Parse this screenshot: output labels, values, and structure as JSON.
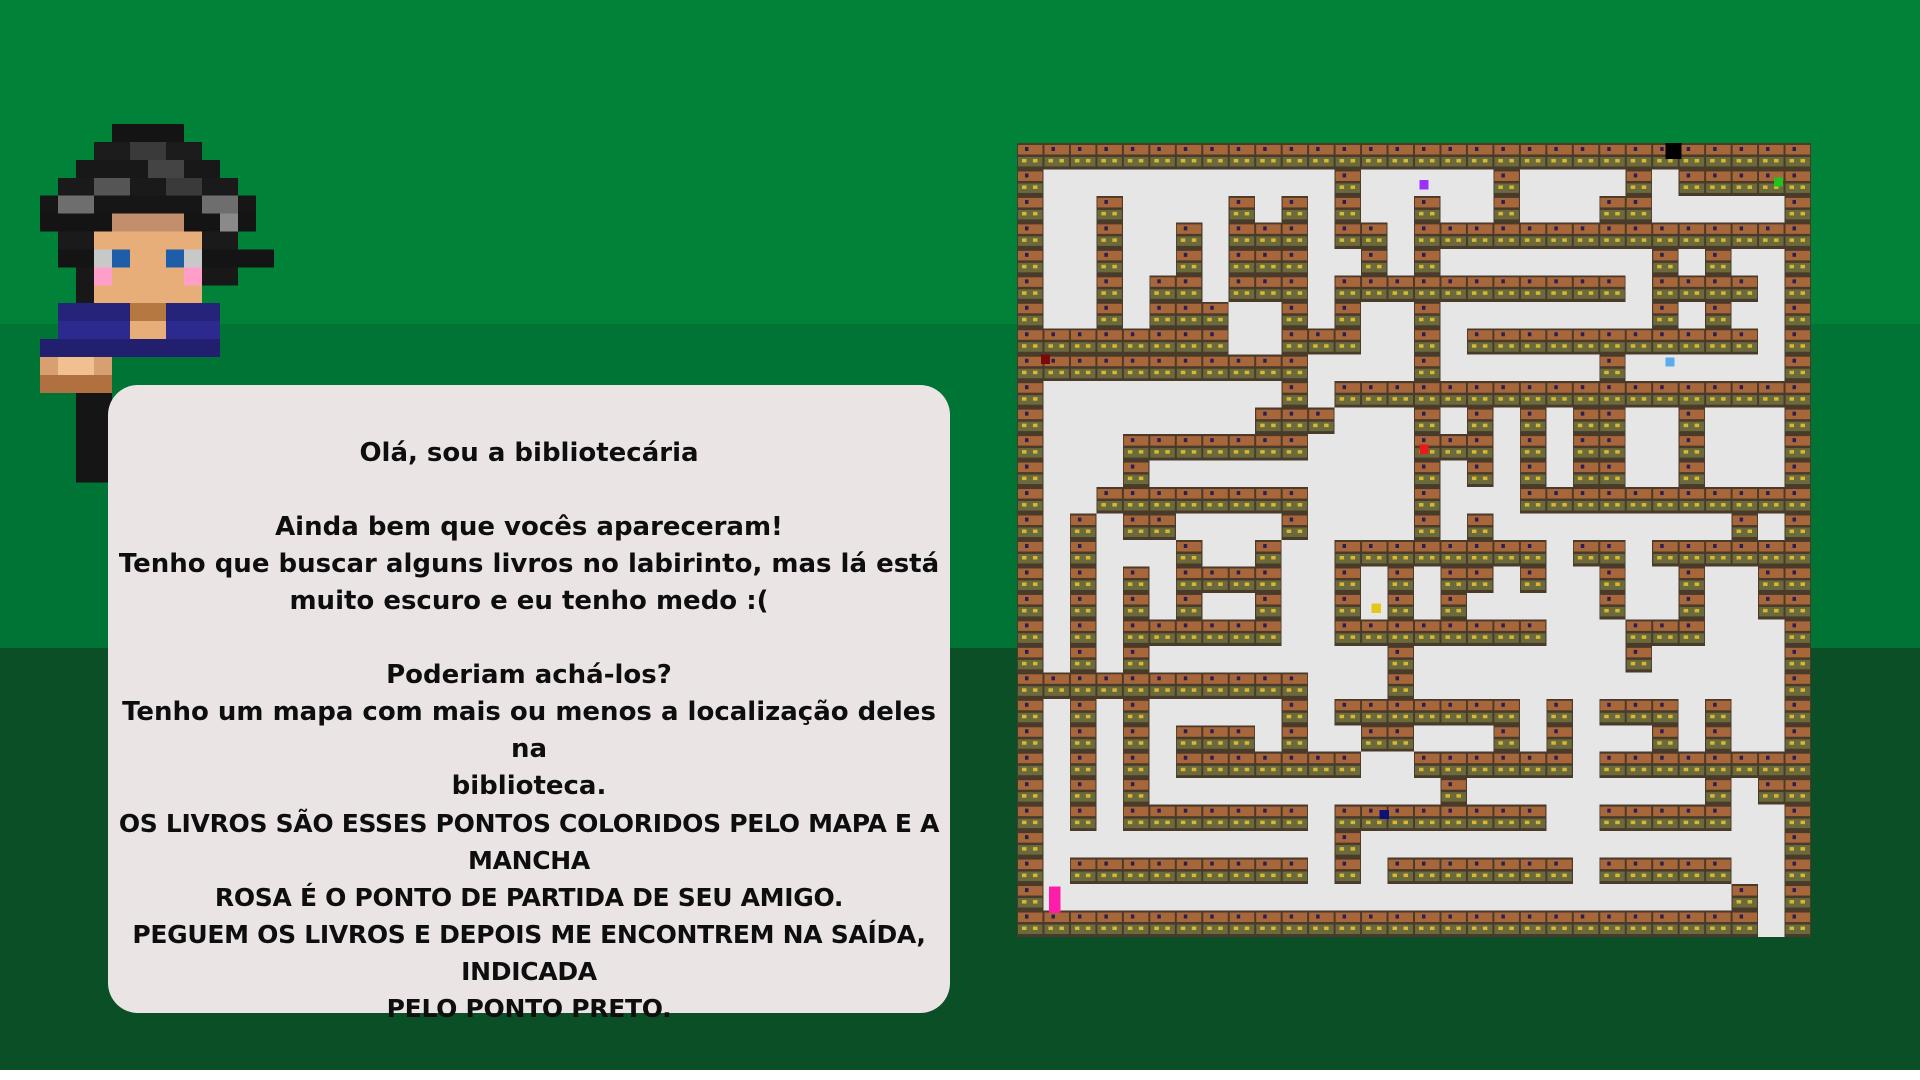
{
  "dialog": {
    "greeting": "Olá, sou a bibliotecária",
    "line_thanks": "Ainda bem que vocês apareceram!",
    "line_books_1": "Tenho que buscar alguns livros no labirinto, mas lá está",
    "line_books_2": "muito escuro e eu tenho medo :(",
    "line_question": "Poderiam achá-los?",
    "line_map_1": "Tenho um mapa com mais ou menos a localização deles na",
    "line_map_2": "biblioteca.",
    "line_caps_1": "OS LIVROS SÃO ESSES PONTOS COLORIDOS PELO MAPA E A MANCHA",
    "line_caps_2": "ROSA É O PONTO DE PARTIDA DE SEU AMIGO.",
    "line_caps_3": "PEGUEM OS LIVROS E DEPOIS ME ENCONTREM NA SAÍDA, INDICADA",
    "line_caps_4": "PELO PONTO PRETO."
  },
  "colors": {
    "band_top": "#008238",
    "band_mid": "#007434",
    "band_bottom": "#0b4f26",
    "dialog_bg": "#eae4e5",
    "maze_floor": "#e6e6e6",
    "start_marker": "#ff1ca8",
    "exit_marker": "#000000"
  },
  "maze": {
    "books": [
      {
        "name": "purple-book",
        "color": "#9b30ff"
      },
      {
        "name": "green-book",
        "color": "#1ec31e"
      },
      {
        "name": "blue-book",
        "color": "#5aaaf0"
      },
      {
        "name": "red-book",
        "color": "#e81a1a"
      },
      {
        "name": "yellow-book",
        "color": "#e3c81b"
      },
      {
        "name": "navy-book",
        "color": "#10107a"
      },
      {
        "name": "darkred-book",
        "color": "#7a0a0a"
      }
    ]
  }
}
